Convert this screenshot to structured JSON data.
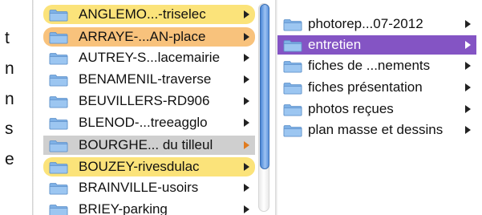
{
  "left_clip_text": [
    "t",
    "n",
    "n",
    "s",
    "e"
  ],
  "column1": {
    "items": [
      {
        "label": "ANGLEMO...-triselec",
        "tag": "yellow",
        "state": ""
      },
      {
        "label": "ARRAYE-...AN-place",
        "tag": "orange",
        "state": ""
      },
      {
        "label": "AUTREY-S...lacemairie",
        "tag": "",
        "state": ""
      },
      {
        "label": "BENAMENIL-traverse",
        "tag": "",
        "state": ""
      },
      {
        "label": "BEUVILLERS-RD906",
        "tag": "",
        "state": ""
      },
      {
        "label": "BLENOD-...treeagglo",
        "tag": "",
        "state": ""
      },
      {
        "label": "BOURGHE... du tilleul",
        "tag": "",
        "state": "selected"
      },
      {
        "label": "BOUZEY-rivesdulac",
        "tag": "yellow",
        "state": ""
      },
      {
        "label": "BRAINVILLE-usoirs",
        "tag": "",
        "state": ""
      },
      {
        "label": "BRIEY-parking",
        "tag": "",
        "state": ""
      }
    ]
  },
  "column2": {
    "items": [
      {
        "label": "photorep...07-2012",
        "state": ""
      },
      {
        "label": "entretien",
        "state": "highlighted"
      },
      {
        "label": "fiches de ...nements",
        "state": ""
      },
      {
        "label": "fiches présentation",
        "state": ""
      },
      {
        "label": "photos reçues",
        "state": ""
      },
      {
        "label": "plan masse et dessins",
        "state": ""
      }
    ]
  },
  "colors": {
    "selection_blue": "#8454c4",
    "selection_gray": "#cfcfcf",
    "tag_yellow": "#fbe37a",
    "tag_orange": "#f8c27c",
    "scroll_thumb": "#5e94dd"
  },
  "icons": {
    "folder": "folder-icon",
    "disclosure": "chevron-right-icon"
  }
}
